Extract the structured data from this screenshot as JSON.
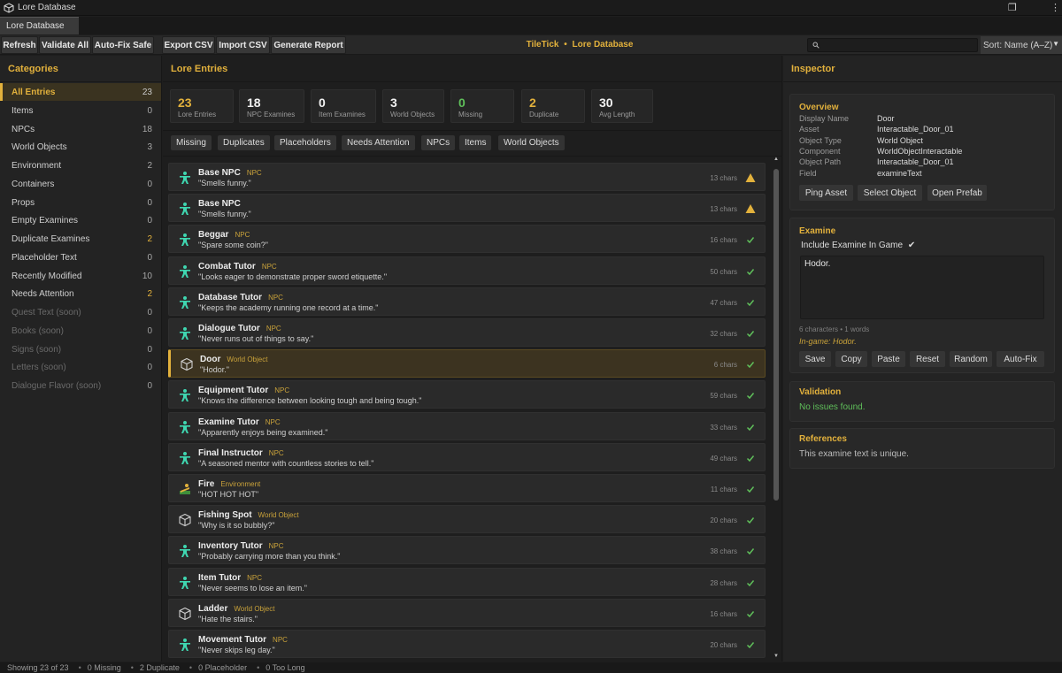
{
  "window": {
    "title": "Lore Database"
  },
  "tab": {
    "label": "Lore Database"
  },
  "toolbar": {
    "buttons": [
      "Refresh",
      "Validate All",
      "Auto-Fix Safe",
      "Export CSV",
      "Import CSV",
      "Generate Report"
    ],
    "center_app": "TileTick",
    "center_sep": "•",
    "center_page": "Lore Database",
    "search_value": "",
    "sort_label": "Sort: Name (A–Z)"
  },
  "categories": {
    "title": "Categories",
    "items": [
      {
        "label": "All Entries",
        "count": "23",
        "state": "active"
      },
      {
        "label": "Items",
        "count": "0",
        "state": "normal"
      },
      {
        "label": "NPCs",
        "count": "18",
        "state": "normal"
      },
      {
        "label": "World Objects",
        "count": "3",
        "state": "normal"
      },
      {
        "label": "Environment",
        "count": "2",
        "state": "normal"
      },
      {
        "label": "Containers",
        "count": "0",
        "state": "normal"
      },
      {
        "label": "Props",
        "count": "0",
        "state": "normal"
      },
      {
        "label": "Empty Examines",
        "count": "0",
        "state": "normal"
      },
      {
        "label": "Duplicate Examines",
        "count": "2",
        "state": "warn"
      },
      {
        "label": "Placeholder Text",
        "count": "0",
        "state": "normal"
      },
      {
        "label": "Recently Modified",
        "count": "10",
        "state": "normal"
      },
      {
        "label": "Needs Attention",
        "count": "2",
        "state": "warn"
      },
      {
        "label": "Quest Text  (soon)",
        "count": "0",
        "state": "soon"
      },
      {
        "label": "Books  (soon)",
        "count": "0",
        "state": "soon"
      },
      {
        "label": "Signs  (soon)",
        "count": "0",
        "state": "soon"
      },
      {
        "label": "Letters  (soon)",
        "count": "0",
        "state": "soon"
      },
      {
        "label": "Dialogue Flavor  (soon)",
        "count": "0",
        "state": "soon"
      }
    ]
  },
  "lore": {
    "title": "Lore Entries",
    "stats": [
      {
        "value": "23",
        "label": "Lore Entries",
        "tone": "gold"
      },
      {
        "value": "18",
        "label": "NPC Examines",
        "tone": "white"
      },
      {
        "value": "0",
        "label": "Item Examines",
        "tone": "white"
      },
      {
        "value": "3",
        "label": "World Objects",
        "tone": "white"
      },
      {
        "value": "0",
        "label": "Missing",
        "tone": "green"
      },
      {
        "value": "2",
        "label": "Duplicate",
        "tone": "gold"
      },
      {
        "value": "30",
        "label": "Avg Length",
        "tone": "white"
      }
    ],
    "filters": [
      "Missing",
      "Duplicates",
      "Placeholders",
      "Needs Attention",
      "NPCs",
      "Items",
      "World Objects"
    ],
    "entries": [
      {
        "name": "Base NPC",
        "type": "NPC",
        "text": "\"Smells funny.\"",
        "chars": "13 chars",
        "status": "warn",
        "icon": "npc-icon",
        "selected": false
      },
      {
        "name": "Base NPC",
        "type": "",
        "text": "\"Smells funny.\"",
        "chars": "13 chars",
        "status": "warn",
        "icon": "npc-icon",
        "selected": false
      },
      {
        "name": "Beggar",
        "type": "NPC",
        "text": "\"Spare some coin?\"",
        "chars": "16 chars",
        "status": "ok",
        "icon": "npc-icon",
        "selected": false
      },
      {
        "name": "Combat Tutor",
        "type": "NPC",
        "text": "\"Looks eager to demonstrate proper sword etiquette.\"",
        "chars": "50 chars",
        "status": "ok",
        "icon": "npc-icon",
        "selected": false
      },
      {
        "name": "Database Tutor",
        "type": "NPC",
        "text": "\"Keeps the academy running one record at a time.\"",
        "chars": "47 chars",
        "status": "ok",
        "icon": "npc-icon",
        "selected": false
      },
      {
        "name": "Dialogue Tutor",
        "type": "NPC",
        "text": "\"Never runs out of things to say.\"",
        "chars": "32 chars",
        "status": "ok",
        "icon": "npc-icon",
        "selected": false
      },
      {
        "name": "Door",
        "type": "World Object",
        "text": "\"Hodor.\"",
        "chars": "6 chars",
        "status": "ok",
        "icon": "cube-icon",
        "selected": true
      },
      {
        "name": "Equipment Tutor",
        "type": "NPC",
        "text": "\"Knows the difference between looking tough and being tough.\"",
        "chars": "59 chars",
        "status": "ok",
        "icon": "npc-icon",
        "selected": false
      },
      {
        "name": "Examine Tutor",
        "type": "NPC",
        "text": "\"Apparently enjoys being examined.\"",
        "chars": "33 chars",
        "status": "ok",
        "icon": "npc-icon",
        "selected": false
      },
      {
        "name": "Final Instructor",
        "type": "NPC",
        "text": "\"A seasoned mentor with countless stories to tell.\"",
        "chars": "49 chars",
        "status": "ok",
        "icon": "npc-icon",
        "selected": false
      },
      {
        "name": "Fire",
        "type": "Environment",
        "text": "\"HOT HOT HOT\"",
        "chars": "11 chars",
        "status": "ok",
        "icon": "environment-icon",
        "selected": false
      },
      {
        "name": "Fishing Spot",
        "type": "World Object",
        "text": "\"Why is it so bubbly?\"",
        "chars": "20 chars",
        "status": "ok",
        "icon": "cube-icon",
        "selected": false
      },
      {
        "name": "Inventory Tutor",
        "type": "NPC",
        "text": "\"Probably carrying more than you think.\"",
        "chars": "38 chars",
        "status": "ok",
        "icon": "npc-icon",
        "selected": false
      },
      {
        "name": "Item Tutor",
        "type": "NPC",
        "text": "\"Never seems to lose an item.\"",
        "chars": "28 chars",
        "status": "ok",
        "icon": "npc-icon",
        "selected": false
      },
      {
        "name": "Ladder",
        "type": "World Object",
        "text": "\"Hate the stairs.\"",
        "chars": "16 chars",
        "status": "ok",
        "icon": "cube-icon",
        "selected": false
      },
      {
        "name": "Movement Tutor",
        "type": "NPC",
        "text": "\"Never skips leg day.\"",
        "chars": "20 chars",
        "status": "ok",
        "icon": "npc-icon",
        "selected": false
      }
    ]
  },
  "inspector": {
    "title": "Inspector",
    "overview": {
      "title": "Overview",
      "fields": [
        {
          "key": "Display Name",
          "value": "Door"
        },
        {
          "key": "Asset",
          "value": "Interactable_Door_01"
        },
        {
          "key": "Object Type",
          "value": "World Object"
        },
        {
          "key": "Component",
          "value": "WorldObjectInteractable"
        },
        {
          "key": "Object Path",
          "value": "Interactable_Door_01"
        },
        {
          "key": "Field",
          "value": "examineText"
        }
      ],
      "buttons": [
        "Ping Asset",
        "Select Object",
        "Open Prefab"
      ]
    },
    "examine": {
      "title": "Examine",
      "include_label": "Include Examine In Game",
      "include_check": "✔",
      "text": "Hodor.",
      "counts": "6 characters  •  1 words",
      "preview": "In-game: Hodor.",
      "buttons": [
        "Save",
        "Copy",
        "Paste",
        "Reset",
        "Random",
        "Auto-Fix"
      ]
    },
    "validation": {
      "title": "Validation",
      "message": "No issues found."
    },
    "references": {
      "title": "References",
      "message": "This examine text is unique."
    }
  },
  "status": [
    "Showing 23 of 23",
    "0 Missing",
    "2 Duplicate",
    "0 Placeholder",
    "0 Too Long"
  ],
  "colors": {
    "accent": "#e2b13c",
    "ok": "#5fbf5a",
    "npc": "#3fd6b0"
  }
}
